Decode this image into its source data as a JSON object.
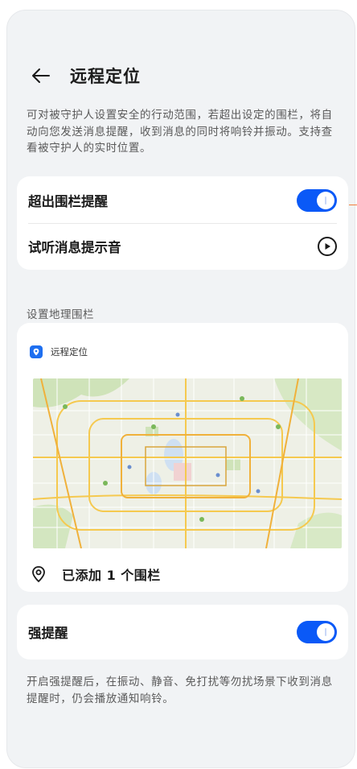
{
  "header": {
    "title": "远程定位"
  },
  "description": "可对被守护人设置安全的行动范围，若超出设定的围栏，将自动向您发送消息提醒，收到消息的同时将响铃并振动。支持查看被守护人的实时位置。",
  "settings_card": {
    "items": [
      {
        "label": "超出围栏提醒",
        "control": "toggle",
        "on": true
      },
      {
        "label": "试听消息提示音",
        "control": "play-icon"
      }
    ]
  },
  "geofence": {
    "section_label": "设置地理围栏",
    "app_name": "远程定位",
    "map_icon": "map",
    "fence_status": "已添加 1 个围栏"
  },
  "strong_alert": {
    "label": "强提醒",
    "on": true,
    "description": "开启强提醒后，在振动、静音、免打扰等勿扰场景下收到消息提醒时，仍会播放通知响铃。"
  },
  "colors": {
    "accent": "#0a59f7",
    "background": "#f1f3f5",
    "card": "#ffffff",
    "edge_marker": "#f27e3c"
  }
}
